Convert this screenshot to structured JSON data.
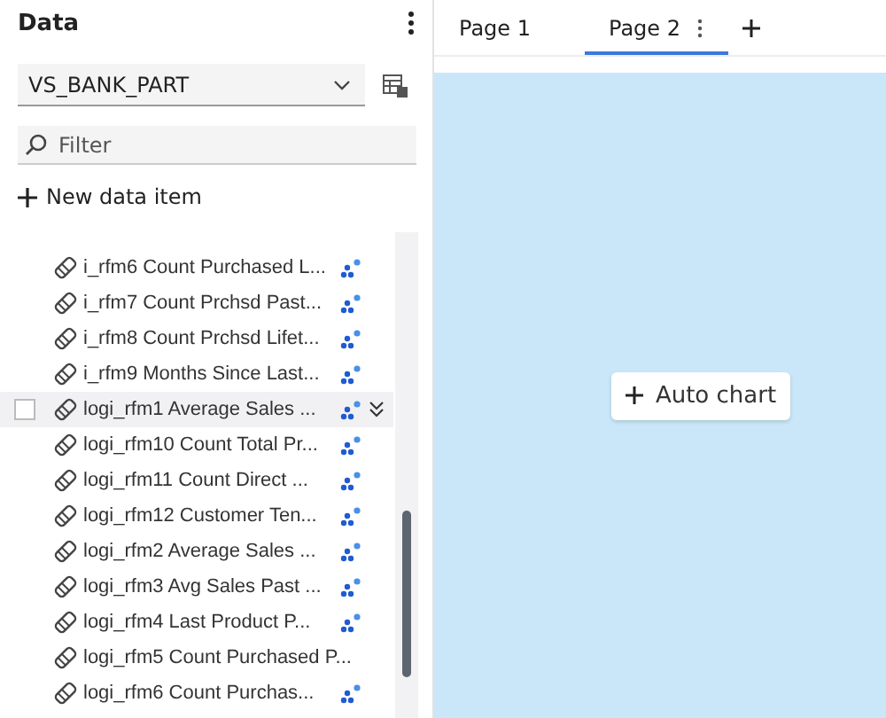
{
  "panel": {
    "title": "Data",
    "source": "VS_BANK_PART",
    "filter_placeholder": "Filter",
    "new_item_label": "New data item"
  },
  "items": [
    {
      "label": "i_rfm6 Count Purchased L...",
      "kind": "related",
      "selected": false
    },
    {
      "label": "i_rfm7 Count Prchsd Past...",
      "kind": "related",
      "selected": false
    },
    {
      "label": "i_rfm8 Count Prchsd Lifet...",
      "kind": "related",
      "selected": false
    },
    {
      "label": "i_rfm9 Months Since Last...",
      "kind": "related",
      "selected": false
    },
    {
      "label": "logi_rfm1 Average Sales ...",
      "kind": "related",
      "selected": true
    },
    {
      "label": "logi_rfm10 Count Total Pr...",
      "kind": "related",
      "selected": false
    },
    {
      "label": "logi_rfm11 Count Direct ...",
      "kind": "related",
      "selected": false
    },
    {
      "label": "logi_rfm12 Customer Ten...",
      "kind": "related",
      "selected": false
    },
    {
      "label": "logi_rfm2 Average Sales ...",
      "kind": "related",
      "selected": false
    },
    {
      "label": "logi_rfm3 Avg Sales Past ...",
      "kind": "related",
      "selected": false
    },
    {
      "label": "logi_rfm4 Last Product P...",
      "kind": "related",
      "selected": false
    },
    {
      "label": "logi_rfm5 Count Purchased P...",
      "kind": "plain",
      "selected": false
    },
    {
      "label": "logi_rfm6 Count Purchas...",
      "kind": "related",
      "selected": false
    }
  ],
  "tabs": [
    {
      "label": "Page 1",
      "selected": false
    },
    {
      "label": "Page 2",
      "selected": true
    }
  ],
  "canvas": {
    "button": "Auto chart"
  }
}
